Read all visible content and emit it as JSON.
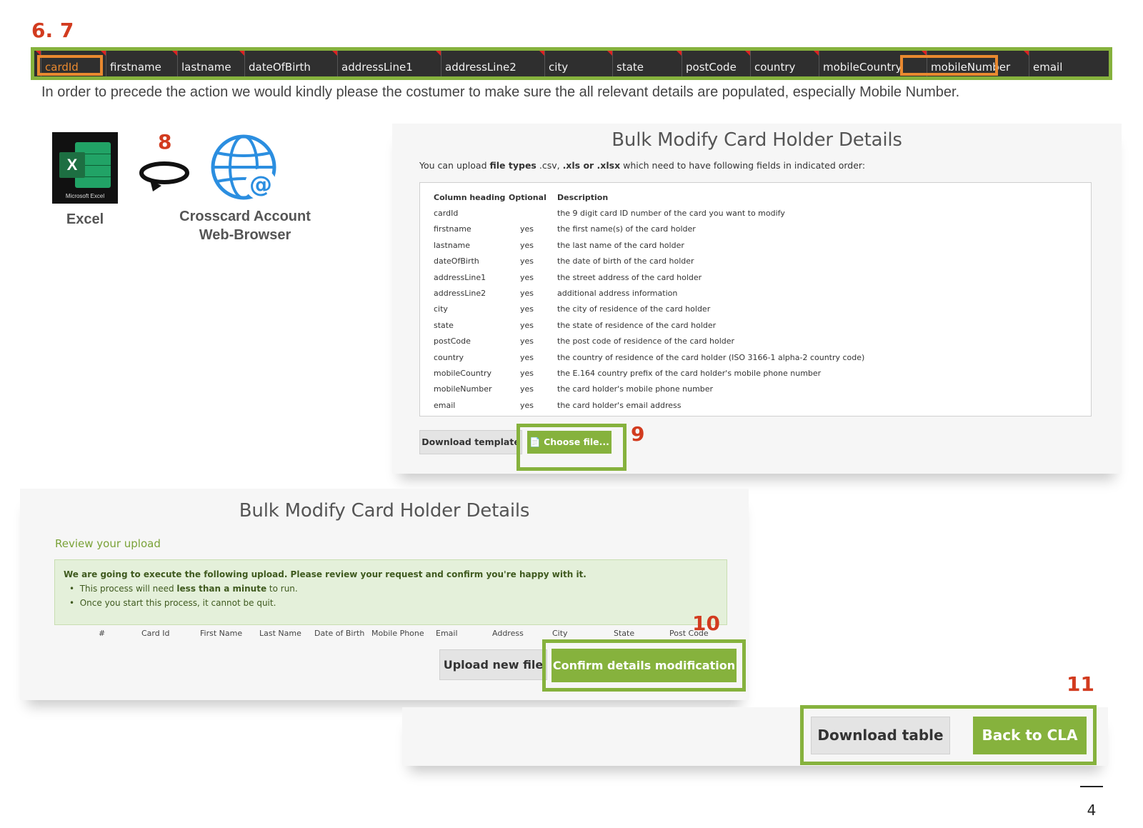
{
  "steps": {
    "s67": "6. 7",
    "s8": "8",
    "s9": "9",
    "s10": "10",
    "s11": "11"
  },
  "header_columns": [
    "cardId",
    "firstname",
    "lastname",
    "dateOfBirth",
    "addressLine1",
    "addressLine2",
    "city",
    "state",
    "postCode",
    "country",
    "mobileCountry",
    "mobileNumber",
    "email"
  ],
  "instruction": "In order to precede the action we would kindly please the costumer to make sure the all relevant details are populated, especially Mobile Number.",
  "excel": {
    "icon_caption": "Microsoft Excel",
    "label": "Excel"
  },
  "browser": {
    "line1": "Crosscard Account",
    "line2": "Web-Browser"
  },
  "panel_a": {
    "title": "Bulk Modify Card Holder Details",
    "intro_pre": "You can upload ",
    "intro_bold1": "file types",
    "intro_mid1": " .csv, ",
    "intro_bold2": ".xls or .xlsx",
    "intro_post": " which need to have following fields in indicated order:",
    "table_headers": {
      "col1": "Column heading",
      "col2": "Optional",
      "col3": "Description"
    },
    "rows": [
      {
        "field": "cardId",
        "optional": "",
        "description": "the 9 digit card ID number of the card you want to modify"
      },
      {
        "field": "firstname",
        "optional": "yes",
        "description": "the first name(s) of the card holder"
      },
      {
        "field": "lastname",
        "optional": "yes",
        "description": "the last name of the card holder"
      },
      {
        "field": "dateOfBirth",
        "optional": "yes",
        "description": "the date of birth of the card holder"
      },
      {
        "field": "addressLine1",
        "optional": "yes",
        "description": "the street address of the card holder"
      },
      {
        "field": "addressLine2",
        "optional": "yes",
        "description": "additional address information"
      },
      {
        "field": "city",
        "optional": "yes",
        "description": "the city of residence of the card holder"
      },
      {
        "field": "state",
        "optional": "yes",
        "description": "the state of residence of the card holder"
      },
      {
        "field": "postCode",
        "optional": "yes",
        "description": "the post code of residence of the card holder"
      },
      {
        "field": "country",
        "optional": "yes",
        "description": "the country of residence of the card holder (ISO 3166-1 alpha-2 country code)"
      },
      {
        "field": "mobileCountry",
        "optional": "yes",
        "description": "the E.164 country prefix of the card holder's mobile phone number"
      },
      {
        "field": "mobileNumber",
        "optional": "yes",
        "description": "the card holder's mobile phone number"
      },
      {
        "field": "email",
        "optional": "yes",
        "description": "the card holder's email address"
      }
    ],
    "download_template": "Download template",
    "choose_file": "Choose file..."
  },
  "panel_b": {
    "title": "Bulk Modify Card Holder Details",
    "subtitle": "Review your upload",
    "notice_heading": "We are going to execute the following upload. Please review your request and confirm you're happy with it.",
    "bullet1_pre": "This process will need ",
    "bullet1_bold": "less than a minute",
    "bullet1_post": " to run.",
    "bullet2": "Once you start this process, it cannot be quit.",
    "columns": [
      "#",
      "Card Id",
      "First Name",
      "Last Name",
      "Date of Birth",
      "Mobile Phone",
      "Email",
      "Address",
      "City",
      "State",
      "Post Code"
    ],
    "upload_new": "Upload new file",
    "confirm": "Confirm details modification"
  },
  "panel_c": {
    "download_table": "Download table",
    "back": "Back to CLA"
  },
  "page_number": "4",
  "colors": {
    "accent_green": "#86b23d",
    "highlight_orange": "#e9892f",
    "step_red": "#d23b1f"
  }
}
